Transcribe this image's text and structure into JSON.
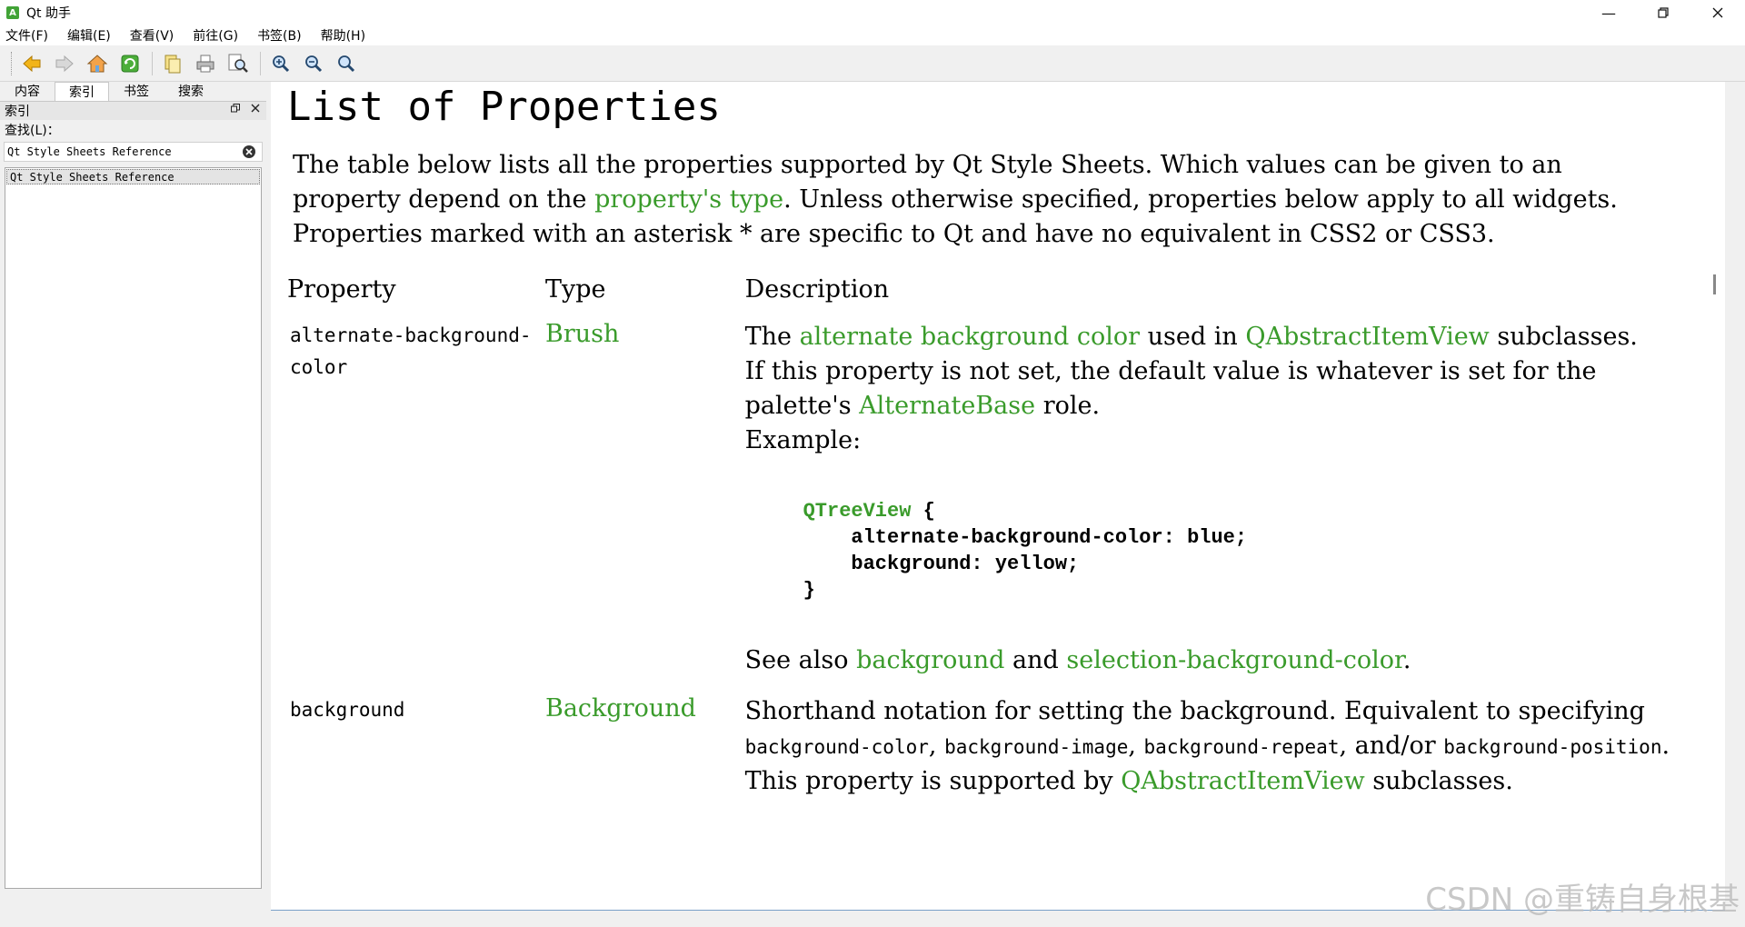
{
  "window": {
    "title": "Qt 助手",
    "app_icon": "A"
  },
  "menu": [
    "文件(F)",
    "编辑(E)",
    "查看(V)",
    "前往(G)",
    "书签(B)",
    "帮助(H)"
  ],
  "tabs": [
    "内容",
    "索引",
    "书签",
    "搜索"
  ],
  "dock": {
    "title": "索引",
    "find_label": "查找(L)："
  },
  "search": {
    "value": "Qt Style Sheets Reference"
  },
  "index_items": [
    "Qt Style Sheets Reference"
  ],
  "doc": {
    "title": "List of Properties",
    "intro": {
      "p1": "The table below lists all the properties supported by Qt Style Sheets. Which values can be given to an property depend on the ",
      "link": "property's type",
      "p2": ". Unless otherwise specified, properties below apply to all widgets. Properties marked with an asterisk * are specific to Qt and have no equivalent in CSS2 or CSS3."
    },
    "headers": {
      "property": "Property",
      "type": "Type",
      "description": "Description"
    },
    "row1": {
      "property": "alternate-background-color",
      "type": "Brush",
      "d1": "The ",
      "d1_link": "alternate background color",
      "d2": " used in ",
      "d2_link": "QAbstractItemView",
      "d3": " subclasses.",
      "d4": "If this property is not set, the default value is whatever is set for the palette's ",
      "d4_link": "AlternateBase",
      "d5": " role.",
      "d6": "Example:",
      "code_selector": "QTreeView",
      "code_open": " {",
      "code_line1": "    alternate-background-color: blue;",
      "code_line2": "    background: yellow;",
      "code_close": "}",
      "see_also": "See also ",
      "see_link1": "background",
      "see_and": " and ",
      "see_link2": "selection-background-color",
      "see_end": "."
    },
    "row2": {
      "property": "background",
      "type": "Background",
      "d1": "Shorthand notation for setting the background. Equivalent to specifying ",
      "c1": "background-color",
      "sep1": ", ",
      "c2": "background-image",
      "sep2": ", ",
      "c3": "background-repeat",
      "sep3": ", and/or ",
      "c4": "background-position",
      "d2": ".",
      "d3": "This property is supported by ",
      "d3_link": "QAbstractItemView",
      "d4": " subclasses."
    }
  },
  "watermark": "CSDN @重铸自身根基",
  "colors": {
    "link": "#3a9b2b",
    "selection": "#e4e4e4"
  }
}
